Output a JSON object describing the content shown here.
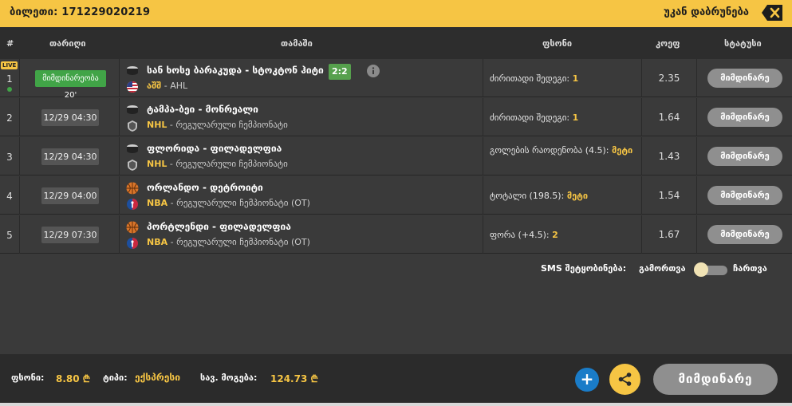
{
  "header": {
    "ticket_label": "ბილეთი: 171229020219",
    "back_label": "უკან დაბრუნება",
    "close_icon": "close-x-icon"
  },
  "columns": {
    "num": "#",
    "date": "თარიღი",
    "match": "თამაში",
    "bet": "ფსონი",
    "odds": "კოეფ",
    "status": "სტატუსი"
  },
  "rows": [
    {
      "num": "1",
      "live": "LIVE",
      "date": "მიმდინარეობა 20'",
      "sport_icon": "hockey-puck-icon",
      "flag_icon": "usa-flag-icon",
      "match": "სან ხოსე ბარაკუდა - სტოკტონ ჰიტი",
      "score": "2:2",
      "league_code": "აშშ",
      "league_rest": " - AHL",
      "bet": "ძირითადი შედეგი: ",
      "pick": "1",
      "odds": "2.35",
      "status": "მიმდინარე"
    },
    {
      "num": "2",
      "date": "12/29 04:30",
      "sport_icon": "hockey-puck-icon",
      "flag_icon": "nhl-logo-icon",
      "match": "ტამპა-ბეი - მონრეალი",
      "league_code": "NHL",
      "league_rest": " - რეგულარული ჩემპიონატი",
      "bet": "ძირითადი შედეგი: ",
      "pick": "1",
      "odds": "1.64",
      "status": "მიმდინარე"
    },
    {
      "num": "3",
      "date": "12/29 04:30",
      "sport_icon": "hockey-puck-icon",
      "flag_icon": "nhl-logo-icon",
      "match": "ფლორიდა - ფილადელფია",
      "league_code": "NHL",
      "league_rest": " - რეგულარული ჩემპიონატი",
      "bet": "გოლების რაოდენობა (4.5): ",
      "pick": "მეტი",
      "odds": "1.43",
      "status": "მიმდინარე"
    },
    {
      "num": "4",
      "date": "12/29 04:00",
      "sport_icon": "basketball-icon",
      "flag_icon": "nba-logo-icon",
      "match": "ორლანდო - დეტროიტი",
      "league_code": "NBA",
      "league_rest": " - რეგულარული ჩემპიონატი (OT)",
      "bet": "ტოტალი (198.5): ",
      "pick": "მეტი",
      "odds": "1.54",
      "status": "მიმდინარე"
    },
    {
      "num": "5",
      "date": "12/29 07:30",
      "sport_icon": "basketball-icon",
      "flag_icon": "nba-logo-icon",
      "match": "პორტლენდი - ფილადელფია",
      "league_code": "NBA",
      "league_rest": " - რეგულარული ჩემპიონატი (OT)",
      "bet": "ფორა (+4.5): ",
      "pick": "2",
      "odds": "1.67",
      "status": "მიმდინარე"
    }
  ],
  "sms": {
    "label": "SMS შეტყობინება:",
    "off_label": "გამორთვა",
    "on_label": "ჩართვა"
  },
  "footer": {
    "stake_label": "ფსონი:",
    "stake_value": "8.80 ₾",
    "type_label": "ტიპი:",
    "type_value": "ექსპრესი",
    "win_label": "სავ. მოგება:",
    "win_value": "124.73 ₾",
    "plus_label": "+",
    "status_label": "მიმდინარე"
  },
  "colors": {
    "accent": "#f6c544",
    "live_green": "#41a447",
    "plus_blue": "#1a7cc8",
    "status_grey": "#8f8f8f"
  }
}
